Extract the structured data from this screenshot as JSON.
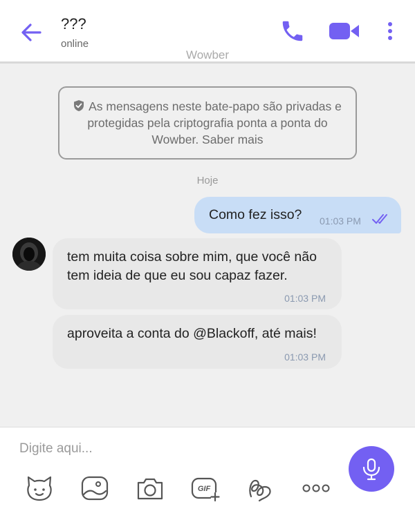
{
  "header": {
    "contact_name": "???",
    "status": "online",
    "app_name": "Wowber",
    "icons": [
      "back-arrow-icon",
      "phone-icon",
      "video-camera-icon",
      "more-vertical-icon"
    ]
  },
  "chat": {
    "encryption_notice": "As mensagens neste bate-papo são privadas e protegidas pela criptografia ponta a ponta do Wowber. Saber mais",
    "date_separator": "Hoje",
    "messages": [
      {
        "direction": "outgoing",
        "text": "Como fez isso?",
        "time": "01:03 PM",
        "status": "read"
      },
      {
        "direction": "incoming",
        "text": "tem muita coisa sobre mim, que você não tem ideia de que eu sou capaz fazer.",
        "time": "01:03 PM"
      },
      {
        "direction": "incoming",
        "text": "aproveita a conta do @Blackoff, até mais!",
        "time": "01:03 PM"
      }
    ]
  },
  "composer": {
    "placeholder": "Digite aqui...",
    "tools": [
      "sticker-icon",
      "gallery-icon",
      "camera-icon",
      "gif-icon",
      "doodle-icon",
      "more-horizontal-icon"
    ],
    "mic_icon": "microphone-icon"
  },
  "colors": {
    "accent": "#7360f2",
    "outgoing_bubble": "#c8ddf6",
    "incoming_bubble": "#e8e8e8",
    "background": "#f0f0f0"
  }
}
